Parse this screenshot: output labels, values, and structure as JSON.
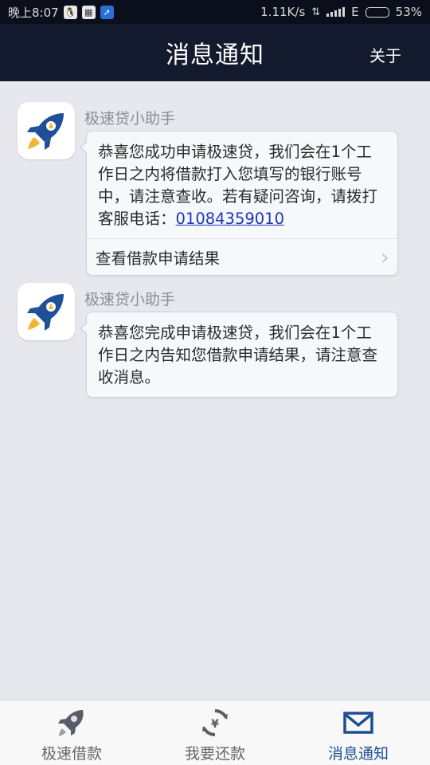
{
  "status_bar": {
    "time": "晚上8:07",
    "network_speed": "1.11K/s",
    "network_type": "E",
    "battery": "53%",
    "battery_level": 0.53
  },
  "header": {
    "title": "消息通知",
    "about_label": "关于"
  },
  "messages": [
    {
      "sender": "极速贷小助手",
      "text": "恭喜您成功申请极速贷，我们会在1个工作日之内将借款打入您填写的银行账号中，请注意查收。若有疑问咨询，请拨打客服电话：",
      "phone": "01084359010",
      "action_label": "查看借款申请结果"
    },
    {
      "sender": "极速贷小助手",
      "text": "恭喜您完成申请极速贷，我们会在1个工作日之内告知您借款申请结果，请注意查收消息。"
    }
  ],
  "tabs": [
    {
      "label": "极速借款",
      "icon": "rocket-icon",
      "active": false
    },
    {
      "label": "我要还款",
      "icon": "repay-icon",
      "active": false
    },
    {
      "label": "消息通知",
      "icon": "mail-icon",
      "active": true
    }
  ],
  "colors": {
    "header_bg": "#141a2e",
    "page_bg": "#e6e8ee",
    "accent": "#1d4e94",
    "link": "#1a38b8"
  }
}
